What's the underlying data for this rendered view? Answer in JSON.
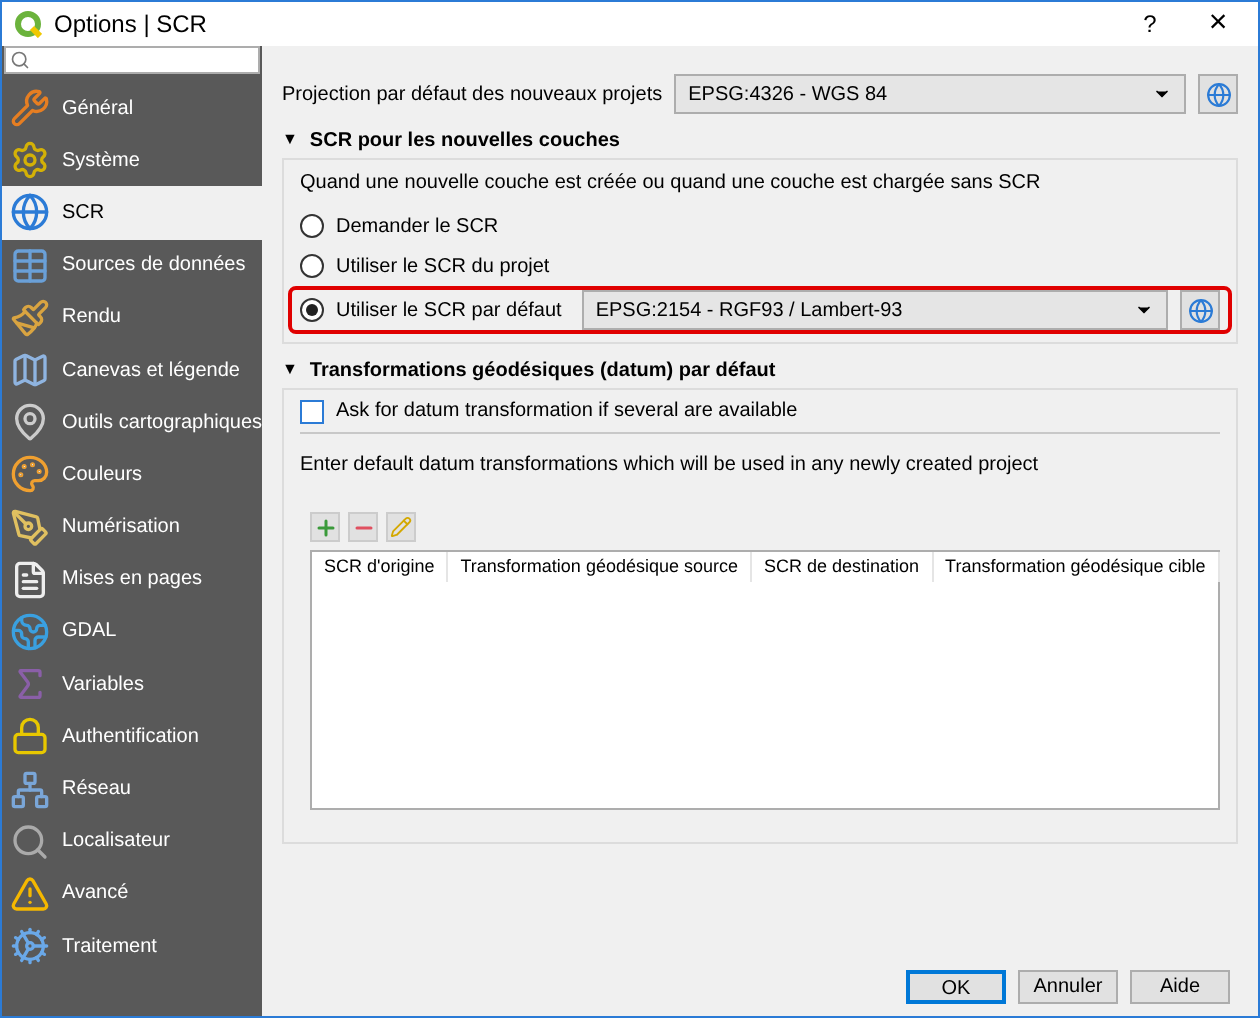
{
  "window": {
    "title": "Options | SCR",
    "help": "?",
    "close": "×"
  },
  "sidebar": {
    "items": [
      {
        "label": "Général",
        "selected": false
      },
      {
        "label": "Système",
        "selected": false
      },
      {
        "label": "SCR",
        "selected": true
      },
      {
        "label": "Sources de données",
        "selected": false
      },
      {
        "label": "Rendu",
        "selected": false
      },
      {
        "label": "Canevas et légende",
        "selected": false
      },
      {
        "label": "Outils cartographiques",
        "selected": false
      },
      {
        "label": "Couleurs",
        "selected": false
      },
      {
        "label": "Numérisation",
        "selected": false
      },
      {
        "label": "Mises en pages",
        "selected": false
      },
      {
        "label": "GDAL",
        "selected": false
      },
      {
        "label": "Variables",
        "selected": false
      },
      {
        "label": "Authentification",
        "selected": false
      },
      {
        "label": "Réseau",
        "selected": false
      },
      {
        "label": "Localisateur",
        "selected": false
      },
      {
        "label": "Avancé",
        "selected": false
      },
      {
        "label": "Traitement",
        "selected": false
      }
    ]
  },
  "projection": {
    "label": "Projection par défaut des nouveaux projets",
    "value": "EPSG:4326 - WGS 84"
  },
  "new_layers": {
    "toggle": "▼",
    "title": "SCR pour les nouvelles couches",
    "expanded": true,
    "description": "Quand une nouvelle couche est créée ou quand une couche est chargée sans SCR",
    "options": [
      {
        "label": "Demander le SCR",
        "selected": false,
        "highlighted": false
      },
      {
        "label": "Utiliser le SCR du projet",
        "selected": false,
        "highlighted": false
      },
      {
        "label": "Utiliser le SCR par défaut",
        "selected": true,
        "value": "EPSG:2154 - RGF93 / Lambert-93",
        "highlighted": true
      }
    ]
  },
  "datum": {
    "toggle": "▼",
    "title": "Transformations géodésiques (datum) par défaut",
    "expanded": true,
    "ask": {
      "label": "Ask for datum transformation if several are available",
      "checked": false
    },
    "description": "Enter default datum transformations which will be used in any newly created project",
    "columns": [
      "SCR d'origine",
      "Transformation géodésique source",
      "SCR de destination",
      "Transformation géodésique cible"
    ]
  },
  "buttons": [
    {
      "label": "OK",
      "default": true
    },
    {
      "label": "Annuler",
      "default": false
    },
    {
      "label": "Aide",
      "default": false
    }
  ]
}
